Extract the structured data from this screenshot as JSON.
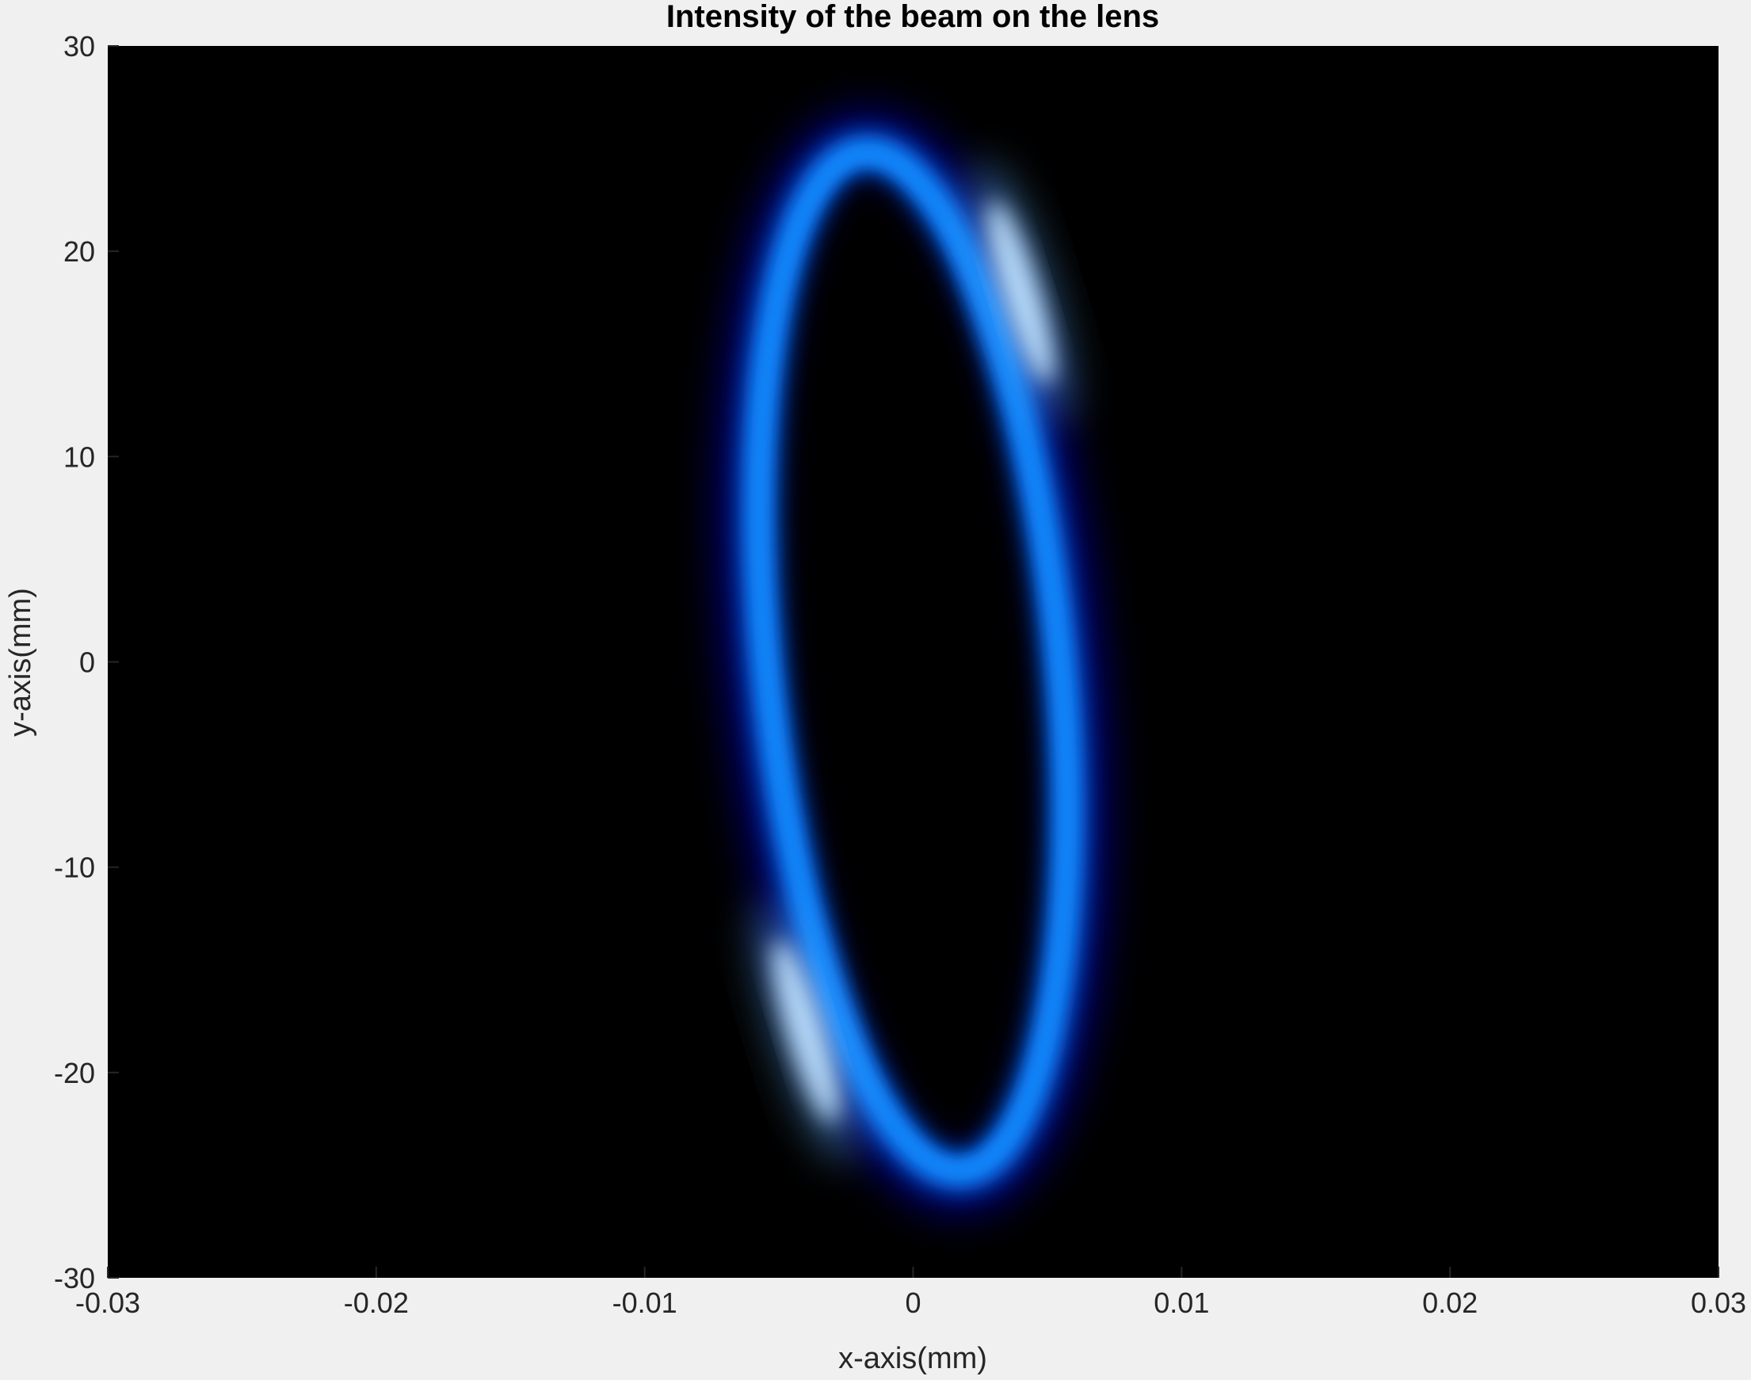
{
  "chart_data": {
    "type": "heatmap",
    "title": "Intensity of the beam on the lens",
    "xlabel": "x-axis(mm)",
    "ylabel": "y-axis(mm)",
    "xlim": [
      -0.03,
      0.03
    ],
    "ylim": [
      -30,
      30
    ],
    "x_ticks": [
      -0.03,
      -0.02,
      -0.01,
      0,
      0.01,
      0.02,
      0.03
    ],
    "x_tick_labels": [
      "-0.03",
      "-0.02",
      "-0.01",
      "0",
      "0.01",
      "0.02",
      "0.03"
    ],
    "y_ticks": [
      30,
      20,
      10,
      0,
      -10,
      -20,
      -30
    ],
    "y_tick_labels": [
      "30",
      "20",
      "10",
      "0",
      "-10",
      "-20",
      "-30"
    ],
    "colormap": "black-blue-white",
    "background_color": "#000000",
    "peak_color": "#ffffff",
    "mid_color": "#0a8cff",
    "low_color": "#00007a",
    "grid": false,
    "colorbar": false,
    "ring": {
      "center_x": 0.0,
      "center_y": 0.0,
      "semi_axis_x": 0.0055,
      "semi_axis_y": 25,
      "tilt_x_per_y": -7.5e-05,
      "peak_intensity_near": [
        [
          0.004,
          18
        ],
        [
          -0.004,
          -18
        ]
      ]
    }
  }
}
